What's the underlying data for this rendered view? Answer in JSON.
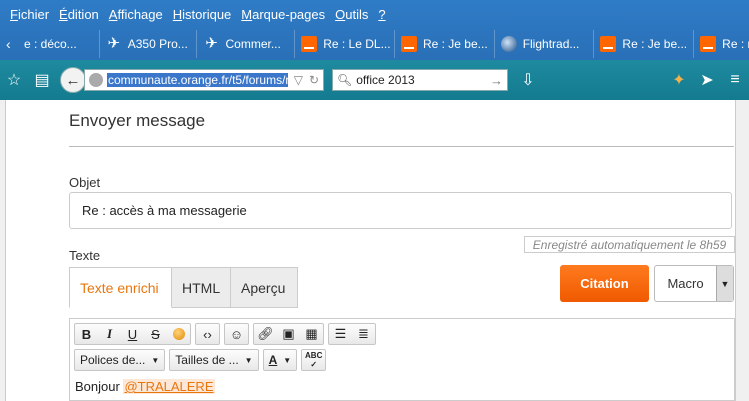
{
  "menu": [
    "Fichier",
    "Édition",
    "Affichage",
    "Historique",
    "Marque-pages",
    "Outils",
    "?"
  ],
  "menu_access_keys": [
    "F",
    "É",
    "A",
    "H",
    "M",
    "O",
    "?"
  ],
  "tabs": [
    {
      "label": "e : déco...",
      "icon": "orange-icon"
    },
    {
      "label": "A350 Pro...",
      "icon": "plane-icon"
    },
    {
      "label": "Commer...",
      "icon": "plane-icon"
    },
    {
      "label": "Re : Le DL...",
      "icon": "orange-icon"
    },
    {
      "label": "Re : Je be...",
      "icon": "orange-icon"
    },
    {
      "label": "Flightrad...",
      "icon": "globe-icon"
    },
    {
      "label": "Re : Je be...",
      "icon": "orange-icon"
    },
    {
      "label": "Re : n",
      "icon": "orange-icon"
    }
  ],
  "navbar": {
    "url": "communaute.orange.fr/t5/forums/re",
    "search_value": "office 2013"
  },
  "page": {
    "title": "Envoyer message",
    "subject_label": "Objet",
    "subject_value": "Re : accès à ma messagerie",
    "text_label": "Texte",
    "autosave": "Enregistré automatiquement le 8h59",
    "editor_tabs": [
      "Texte enrichi",
      "HTML",
      "Aperçu"
    ],
    "citation_button": "Citation",
    "macro_label": "Macro",
    "font_combo": "Polices de...",
    "size_combo": "Tailles de ...",
    "body_text": "Bonjour",
    "mention": "@TRALALERE"
  },
  "colors": {
    "accent_orange": "#f05a00",
    "chrome_blue": "#2f7cc6",
    "navbar_teal": "#1e8aa0"
  }
}
